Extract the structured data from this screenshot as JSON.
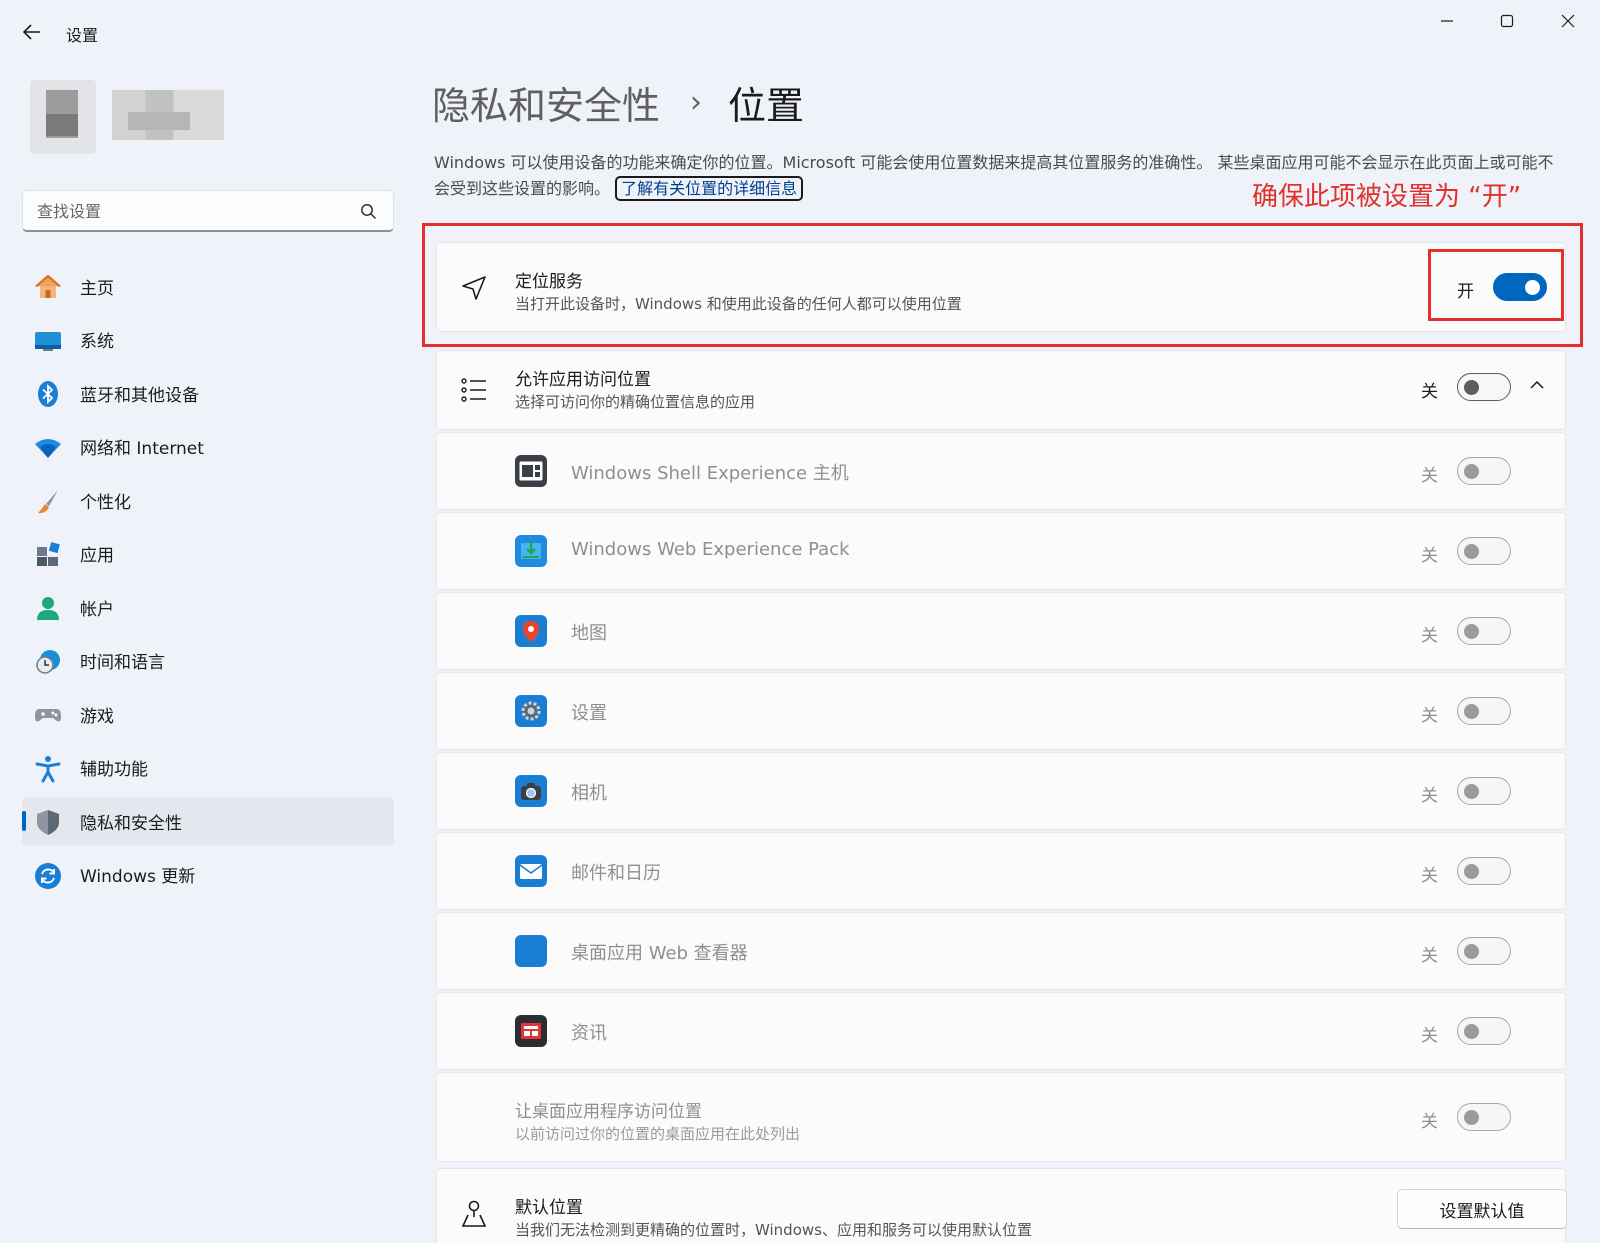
{
  "window": {
    "title": "设置",
    "controls": [
      "minimize-icon",
      "maximize-icon",
      "close-icon"
    ]
  },
  "sidebar": {
    "search_placeholder": "查找设置",
    "items": [
      {
        "label": "主页",
        "icon": "home-icon"
      },
      {
        "label": "系统",
        "icon": "system-icon"
      },
      {
        "label": "蓝牙和其他设备",
        "icon": "bluetooth-icon"
      },
      {
        "label": "网络和 Internet",
        "icon": "wifi-icon"
      },
      {
        "label": "个性化",
        "icon": "brush-icon"
      },
      {
        "label": "应用",
        "icon": "apps-icon"
      },
      {
        "label": "帐户",
        "icon": "account-icon"
      },
      {
        "label": "时间和语言",
        "icon": "time-language-icon"
      },
      {
        "label": "游戏",
        "icon": "gamepad-icon"
      },
      {
        "label": "辅助功能",
        "icon": "accessibility-icon"
      },
      {
        "label": "隐私和安全性",
        "icon": "shield-icon",
        "active": true
      },
      {
        "label": "Windows 更新",
        "icon": "windows-update-icon"
      }
    ]
  },
  "breadcrumb": {
    "parent": "隐私和安全性",
    "separator": "›",
    "current": "位置"
  },
  "description": {
    "text": "Windows 可以使用设备的功能来确定你的位置。Microsoft 可能会使用位置数据来提高其位置服务的准确性。 某些桌面应用可能不会显示在此页面上或可能不会受到这些设置的影响。 ",
    "link": "了解有关位置的详细信息"
  },
  "annotation": {
    "text": "确保此项被设置为 “开”",
    "color": "#e2312a"
  },
  "location_service": {
    "title": "定位服务",
    "subtitle": "当打开此设备时，Windows 和使用此设备的任何人都可以使用位置",
    "state": "开",
    "on": true
  },
  "app_access": {
    "title": "允许应用访问位置",
    "subtitle": "选择可访问你的精确位置信息的应用",
    "state": "关",
    "on": false,
    "expanded": true
  },
  "apps": [
    {
      "name": "Windows Shell Experience 主机",
      "state": "关",
      "icon": "shell-experience-icon"
    },
    {
      "name": "Windows Web Experience Pack",
      "state": "关",
      "icon": "web-experience-icon"
    },
    {
      "name": "地图",
      "state": "关",
      "icon": "maps-icon"
    },
    {
      "name": "设置",
      "state": "关",
      "icon": "settings-gear-icon"
    },
    {
      "name": "相机",
      "state": "关",
      "icon": "camera-icon"
    },
    {
      "name": "邮件和日历",
      "state": "关",
      "icon": "mail-icon"
    },
    {
      "name": "桌面应用 Web 查看器",
      "state": "关",
      "icon": "web-viewer-icon"
    },
    {
      "name": "资讯",
      "state": "关",
      "icon": "news-icon"
    }
  ],
  "desktop_apps": {
    "title": "让桌面应用程序访问位置",
    "subtitle": "以前访问过你的位置的桌面应用在此处列出",
    "state": "关"
  },
  "default_location": {
    "title": "默认位置",
    "subtitle": "当我们无法检测到更精确的位置时，Windows、应用和服务可以使用默认位置",
    "button": "设置默认值"
  },
  "colors": {
    "accent": "#0067c0",
    "background": "#eff3f9",
    "annotation_red": "#e2312a"
  }
}
